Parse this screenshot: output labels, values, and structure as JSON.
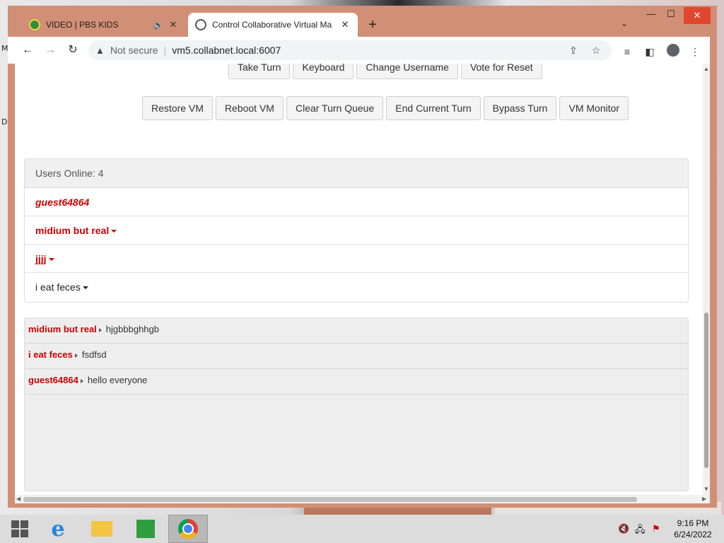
{
  "browser": {
    "tabs": [
      {
        "title": "VIDEO | PBS KIDS",
        "active": false,
        "muted_icon": "speaker-icon"
      },
      {
        "title": "Control Collaborative Virtual Ma",
        "active": true
      }
    ],
    "address": {
      "warning": "Not secure",
      "url": "vm5.collabnet.local:6007"
    }
  },
  "vm_controls": {
    "row1": [
      "Take Turn",
      "Keyboard",
      "Change Username",
      "Vote for Reset"
    ],
    "row2": [
      "Restore VM",
      "Reboot VM",
      "Clear Turn Queue",
      "End Current Turn",
      "Bypass Turn",
      "VM Monitor"
    ]
  },
  "users_panel": {
    "header": "Users Online: 4",
    "users": [
      {
        "name": "guest64864",
        "style": "red-italic",
        "has_menu": false
      },
      {
        "name": "midium but real",
        "style": "red",
        "has_menu": true
      },
      {
        "name": "jjjj",
        "style": "red",
        "has_menu": true
      },
      {
        "name": "i eat feces",
        "style": "plain",
        "has_menu": true
      }
    ]
  },
  "chat": {
    "messages": [
      {
        "user": "midium but real",
        "text": "hjgbbbghhgb"
      },
      {
        "user": "i eat feces",
        "text": "fsdfsd"
      },
      {
        "user": "guest64864",
        "text": "hello everyone"
      }
    ]
  },
  "taskbar": {
    "time": "9:16 PM",
    "date": "6/24/2022"
  },
  "colors": {
    "window_frame": "#d18f75",
    "username_red": "#cc0000",
    "close_button": "#e0472e"
  }
}
